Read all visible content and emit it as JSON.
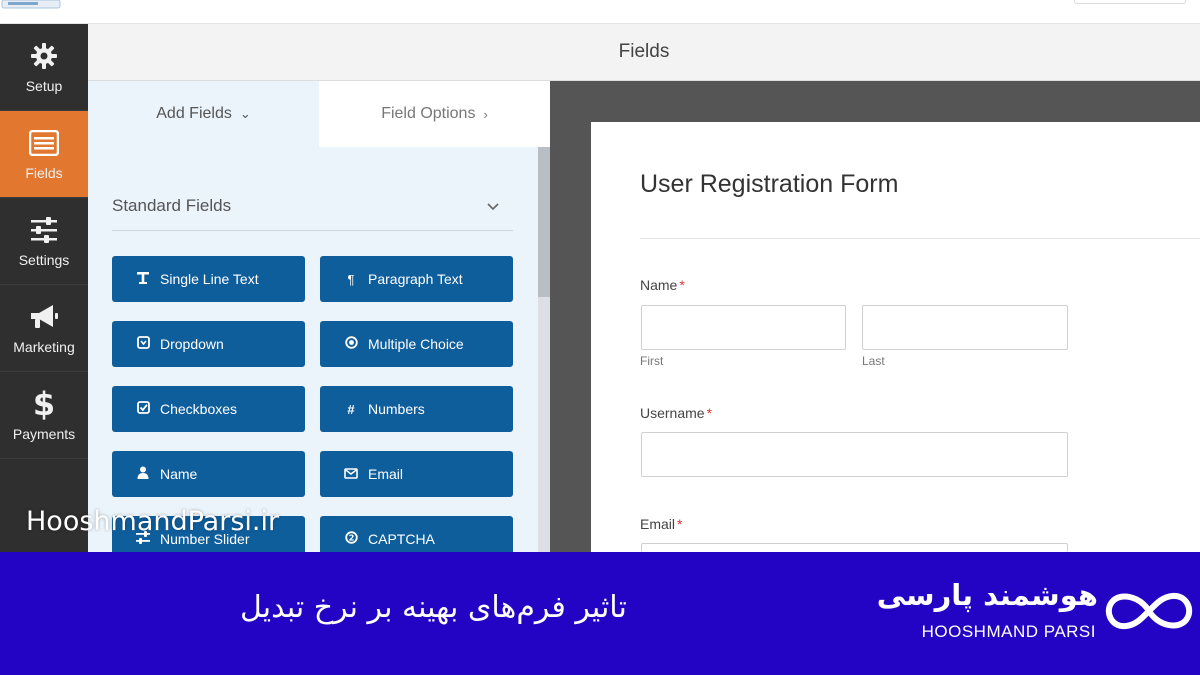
{
  "header": {
    "title": "Fields"
  },
  "sidebar": {
    "items": [
      {
        "label": "Setup",
        "icon": "gear-icon"
      },
      {
        "label": "Fields",
        "icon": "fields-icon",
        "active": true
      },
      {
        "label": "Settings",
        "icon": "sliders-icon"
      },
      {
        "label": "Marketing",
        "icon": "megaphone-icon"
      },
      {
        "label": "Payments",
        "icon": "dollar-icon"
      }
    ]
  },
  "panel": {
    "tabs": [
      {
        "label": "Add Fields",
        "chevron": "⌄"
      },
      {
        "label": "Field Options",
        "chevron": "›"
      }
    ],
    "section_title": "Standard Fields",
    "buttons": [
      {
        "label": "Single Line Text",
        "icon": "text-icon"
      },
      {
        "label": "Paragraph Text",
        "icon": "paragraph-icon"
      },
      {
        "label": "Dropdown",
        "icon": "dropdown-icon"
      },
      {
        "label": "Multiple Choice",
        "icon": "radio-icon"
      },
      {
        "label": "Checkboxes",
        "icon": "checkbox-icon"
      },
      {
        "label": "Numbers",
        "icon": "hash-icon"
      },
      {
        "label": "Name",
        "icon": "user-icon"
      },
      {
        "label": "Email",
        "icon": "envelope-icon"
      },
      {
        "label": "Number Slider",
        "icon": "slider-icon"
      },
      {
        "label": "CAPTCHA",
        "icon": "captcha-icon"
      }
    ]
  },
  "form": {
    "title": "User Registration Form",
    "name_label": "Name",
    "first_label": "First",
    "last_label": "Last",
    "username_label": "Username",
    "email_label": "Email",
    "required_mark": "*"
  },
  "watermark": "HooshmandParsi.ir",
  "banner": {
    "title": "تاثیر فرم‌های بهینه بر نرخ تبدیل",
    "brand_fa": "هوشمند پارسی",
    "brand_en": "HOOSHMAND PARSI"
  },
  "colors": {
    "accent_orange": "#e27730",
    "button_blue": "#0f5e9c",
    "banner_blue": "#2303c4",
    "sidebar_dark": "#2f2f2f"
  }
}
